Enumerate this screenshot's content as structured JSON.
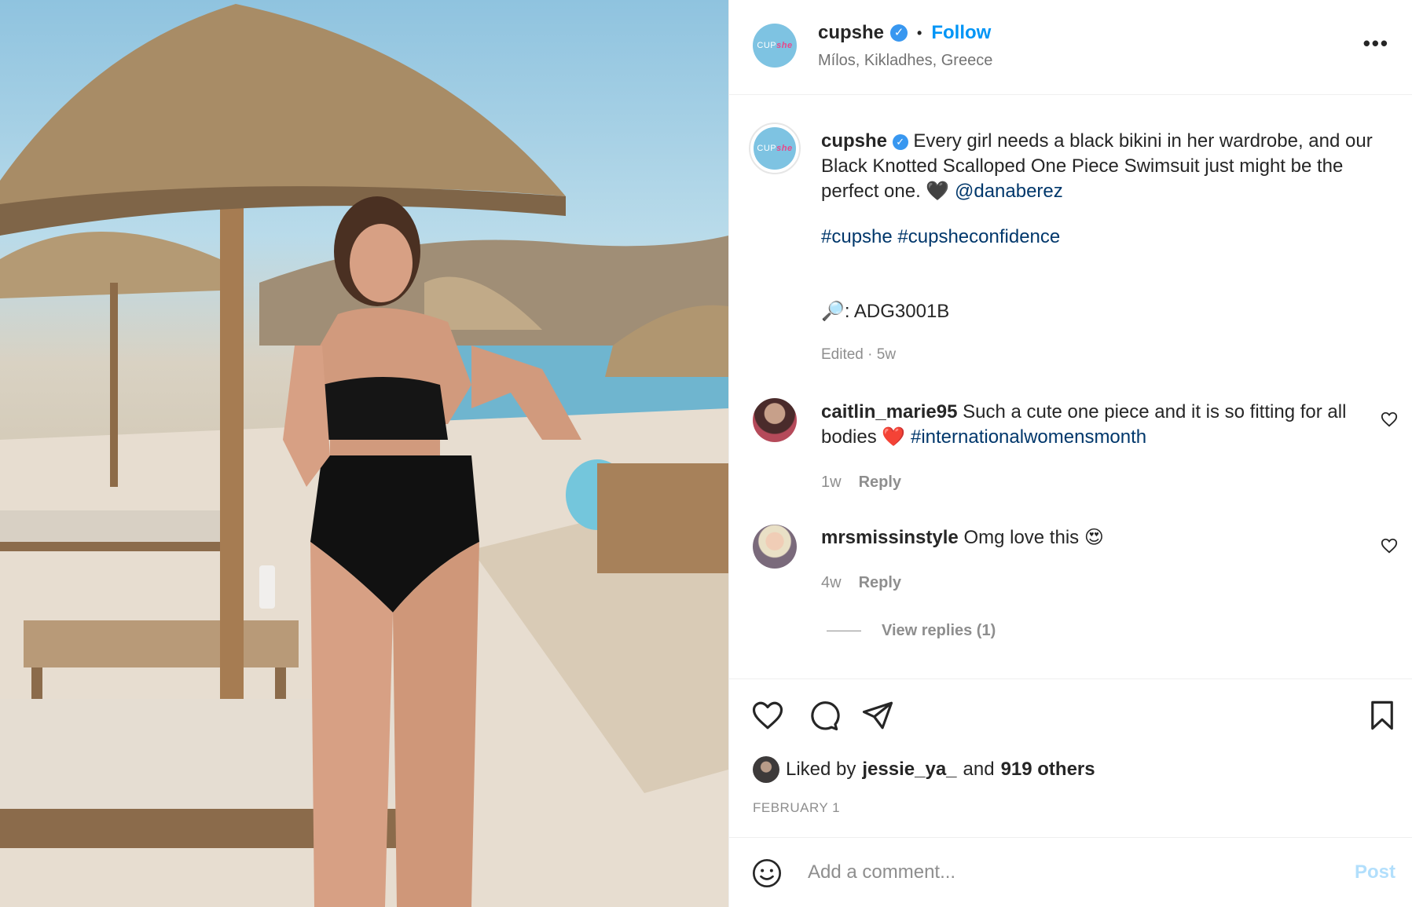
{
  "header": {
    "username": "cupshe",
    "verified_mark": "✓",
    "separator": "•",
    "follow_label": "Follow",
    "location": "Mílos, Kikladhes, Greece",
    "more_label": "•••",
    "avatar_text_a": "CUP",
    "avatar_text_b": "she"
  },
  "caption": {
    "username": "cupshe",
    "text": "Every girl needs a black bikini in her wardrobe, and our Black Knotted Scalloped One Piece Swimsuit just might be the perfect one.",
    "emoji": "🖤",
    "mention": "@danaberez",
    "hashtags": "#cupshe #cupsheconfidence",
    "sku": "🔎: ADG3001B",
    "meta": "Edited · 5w"
  },
  "comments": [
    {
      "username": "caitlin_marie95",
      "text": "Such a cute one piece and it is so fitting for all bodies",
      "emoji": "❤️",
      "hashtag": "#internationalwomensmonth",
      "time": "1w",
      "reply_label": "Reply"
    },
    {
      "username": "mrsmissinstyle",
      "text": "Omg love this",
      "emoji": "😍",
      "time": "4w",
      "reply_label": "Reply"
    }
  ],
  "view_replies": "View replies (1)",
  "likes": {
    "prefix": "Liked by",
    "user": "jessie_ya_",
    "middle": "and",
    "others": "919 others"
  },
  "date": "FEBRUARY 1",
  "comment_box": {
    "placeholder": "Add a comment...",
    "post_label": "Post"
  },
  "icons": {
    "like": "heart-icon",
    "comment": "comment-bubble-icon",
    "share": "paper-plane-icon",
    "save": "bookmark-icon",
    "emoji": "smiley-icon"
  },
  "colors": {
    "follow": "#0095f6",
    "link": "#00376b",
    "muted": "#8e8e8e",
    "post_disabled": "#b2dffc",
    "verified": "#3897f0"
  }
}
